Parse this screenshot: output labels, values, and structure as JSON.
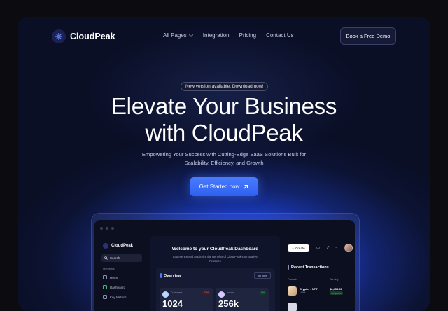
{
  "brand": {
    "name": "CloudPeak"
  },
  "nav": {
    "items": [
      {
        "label": "All Pages",
        "icon": "chevron-down-icon"
      },
      {
        "label": "Integration"
      },
      {
        "label": "Pricing"
      },
      {
        "label": "Contact Us"
      }
    ],
    "cta_label": "Book a Free Demo"
  },
  "hero": {
    "badge": "New version available. Download now!",
    "title_line1": "Elevate Your Business",
    "title_line2": "with CloudPeak",
    "subtitle_line1": "Empowering Your Success with Cutting-Edge SaaS Solutions Built for",
    "subtitle_line2": "Scalability, Efficiency, and Growth",
    "cta_label": "Get Started now",
    "cta_icon": "arrow-up-right-icon"
  },
  "colors": {
    "accent": "#3f6ffa",
    "background": "#0b0f26",
    "success": "#3fd07f",
    "danger": "#ff6b7d"
  },
  "dashboard": {
    "brand": "CloudPeak",
    "search_label": "Search",
    "section_label": "Members",
    "sidebar": [
      {
        "label": "Home",
        "icon": "home-icon"
      },
      {
        "label": "Dashboard",
        "icon": "dashboard-icon"
      },
      {
        "label": "Key Metrics",
        "icon": "metrics-icon"
      }
    ],
    "welcome_title": "Welcome to your CloudPeak Dashboard",
    "welcome_sub": "Experience and Maximize the Benefits of CloudPeak's Innovative Features",
    "overview": {
      "title": "Overview",
      "filter": "All time",
      "stats": [
        {
          "label": "Customers",
          "change": "12%",
          "value": "1024"
        },
        {
          "label": "Income",
          "change": "9%",
          "value": "256k"
        }
      ]
    },
    "create_label": "Create",
    "transactions": {
      "title": "Recent Transactions",
      "col_products": "Products",
      "col_earning": "Earning",
      "rows": [
        {
          "name": "Crypter - NFT",
          "sub": "UI Kit",
          "amount": "$2,453.80",
          "status": "Completed"
        }
      ]
    }
  }
}
